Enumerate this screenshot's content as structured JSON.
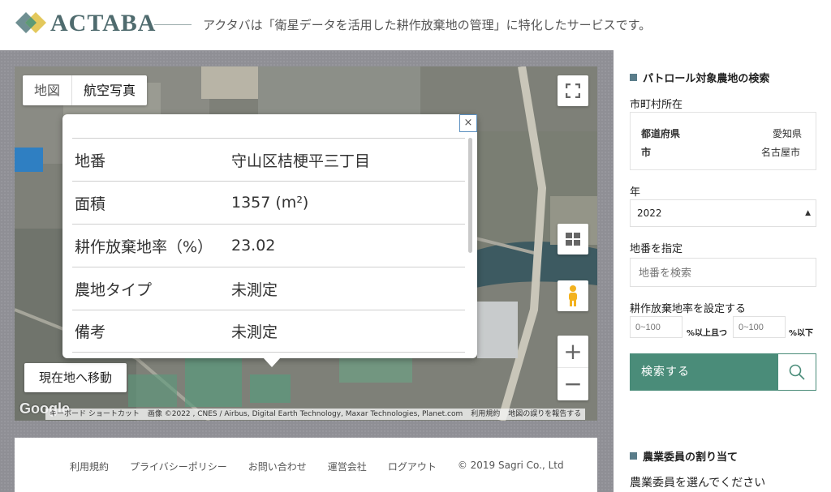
{
  "header": {
    "brand": "ACTABA",
    "tagline": "アクタバは「衛星データを活用した耕作放棄地の管理」に特化したサービスです。"
  },
  "map": {
    "map_type_tabs": [
      "地図",
      "航空写真"
    ],
    "current_location_button": "現在地へ移動",
    "zoom_in": "+",
    "zoom_out": "−",
    "google_logo": "Google",
    "attribution": {
      "shortcuts": "キーボード ショートカット",
      "imagery": "画像 ©2022 , CNES / Airbus, Digital Earth Technology, Maxar Technologies, Planet.com",
      "terms": "利用規約",
      "report": "地図の誤りを報告する"
    },
    "info_window": {
      "close": "×",
      "rows": [
        {
          "label": "地番",
          "value": "守山区桔梗平三丁目"
        },
        {
          "label": "面積",
          "value": "1357 (m²)"
        },
        {
          "label": "耕作放棄地率（%）",
          "value": "23.02"
        },
        {
          "label": "農地タイプ",
          "value": "未測定"
        },
        {
          "label": "備考",
          "value": "未測定"
        }
      ]
    }
  },
  "footer": {
    "links": [
      "利用規約",
      "プライバシーポリシー",
      "お問い合わせ",
      "運営会社",
      "ログアウト"
    ],
    "copyright": "© 2019 Sagri Co., Ltd"
  },
  "panel": {
    "search_title": "パトロール対象農地の検索",
    "municipality_label": "市町村所在",
    "prefecture_label": "都道府県",
    "prefecture_value": "愛知県",
    "city_label": "市",
    "city_value": "名古屋市",
    "year_label": "年",
    "year_value": "2022",
    "lot_label": "地番を指定",
    "lot_placeholder": "地番を検索",
    "rate_label": "耕作放棄地率を設定する",
    "rate_min_placeholder": "0~100",
    "rate_min_suffix": "%以上且つ",
    "rate_max_placeholder": "0~100",
    "rate_max_suffix": "%以下",
    "search_button": "検索する",
    "assign_title": "農業委員の割り当て",
    "assign_label": "農業委員を選んでください"
  },
  "colors": {
    "accent": "#4a8c79",
    "brand": "#4f6b6e",
    "section_marker": "#5a7d8a"
  }
}
